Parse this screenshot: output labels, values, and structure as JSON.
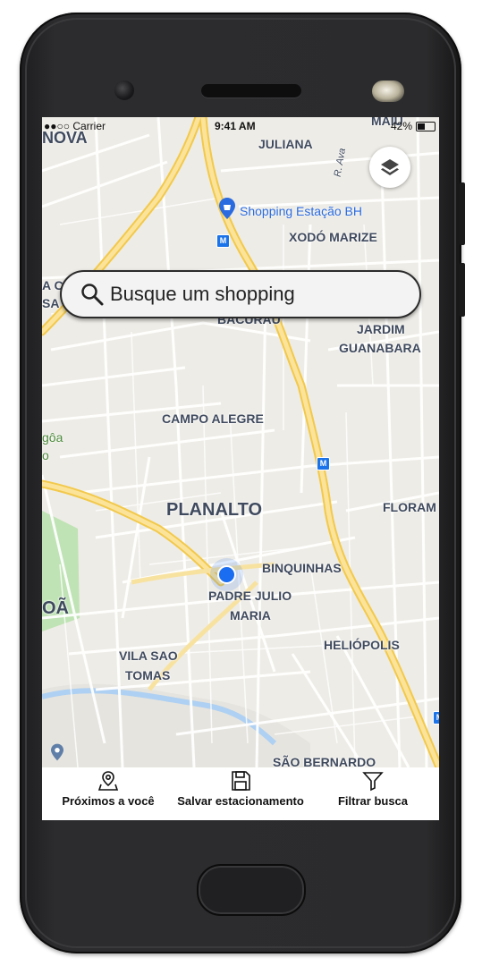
{
  "status_bar": {
    "carrier": "●●○○ Carrier",
    "time": "9:41 AM",
    "battery": "42%"
  },
  "search": {
    "placeholder": "Busque um shopping"
  },
  "map": {
    "poi": {
      "label": "Shopping Estação BH"
    },
    "labels": {
      "nova": "NOVA",
      "juliana": "JULIANA",
      "maiu": "MAIU",
      "r_ava": "R. Ava",
      "xodo_marize": "XODÓ MARIZE",
      "bacurau": "BACURAU",
      "jardim": "JARDIM",
      "guanabara": "GUANABARA",
      "campo_alegre": "CAMPO ALEGRE",
      "lagoa_1": "gôa",
      "lagoa_2": "o",
      "planalto": "PLANALTO",
      "floram": "FLORAM",
      "binquinhas": "BINQUINHAS",
      "padre_julio": "PADRE JULIO",
      "maria": "MARIA",
      "oa": "OÃ",
      "heliopolis": "HELIÓPOLIS",
      "vila_sao": "VILA SAO",
      "tomas": "TOMAS",
      "sao_bernardo": "SÃO BERNARDO",
      "a_c": "A C",
      "sa": "SA"
    },
    "metro_symbol": "M",
    "colors": {
      "road_major": "#f7d56b",
      "road_minor": "#ffffff",
      "background": "#eeece6",
      "park": "#bfe3b4",
      "water": "#aed0f2",
      "label": "#3f4a5e",
      "poi": "#2a6be0"
    }
  },
  "bottom_nav": {
    "items": [
      {
        "label": "Próximos a você",
        "icon": "map-pin-icon"
      },
      {
        "label": "Salvar estacionamento",
        "icon": "save-icon"
      },
      {
        "label": "Filtrar busca",
        "icon": "filter-icon"
      }
    ]
  }
}
